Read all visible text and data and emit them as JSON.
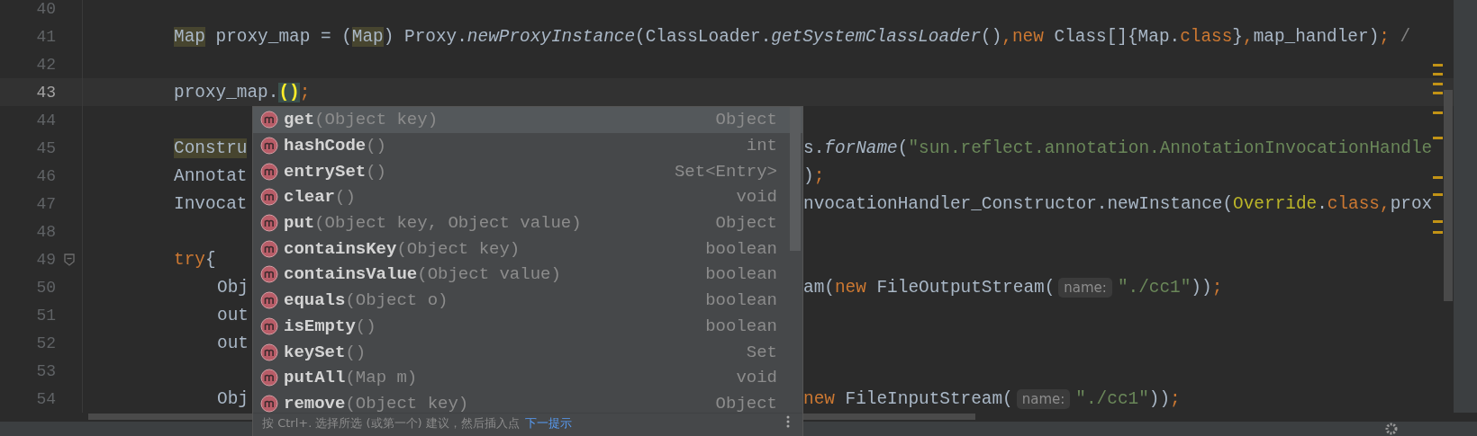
{
  "editor": {
    "lines": [
      {
        "number": "40",
        "current": false
      },
      {
        "number": "41",
        "current": false,
        "text": [
          {
            "kind": "code",
            "tokens": [
              {
                "t": "Map",
                "kind": "usage"
              },
              {
                "t": " proxy_map = (",
                "kind": "plain"
              },
              {
                "t": "Map",
                "kind": "usage"
              },
              {
                "t": ") Proxy.",
                "kind": "plain"
              },
              {
                "t": "newProxyInstance",
                "kind": "method"
              },
              {
                "t": "(ClassLoader.",
                "kind": "plain"
              },
              {
                "t": "getSystemClassLoader",
                "kind": "method"
              },
              {
                "t": "()",
                "kind": "plain"
              },
              {
                "t": ",new",
                "kind": "keyword"
              },
              {
                "t": " Class[]{Map.",
                "kind": "plain"
              },
              {
                "t": "class",
                "kind": "keyword"
              },
              {
                "t": "}",
                "kind": "plain"
              },
              {
                "t": ",",
                "kind": "keyword"
              },
              {
                "t": "map_handler)",
                "kind": "plain"
              },
              {
                "t": ";",
                "kind": "keyword"
              },
              {
                "t": " /",
                "kind": "comment"
              }
            ]
          }
        ]
      },
      {
        "number": "42",
        "current": false
      },
      {
        "number": "43",
        "current": true,
        "text": [
          {
            "kind": "code",
            "tokens": [
              {
                "t": "proxy_map.",
                "kind": "plain"
              },
              {
                "t": "()",
                "kind": "brace-match"
              },
              {
                "t": ";",
                "kind": "keyword"
              }
            ]
          }
        ]
      },
      {
        "number": "44",
        "current": false
      },
      {
        "number": "45",
        "current": false,
        "text": [
          {
            "kind": "code",
            "tokens": [
              {
                "t": "Constru",
                "kind": "usage"
              }
            ]
          }
        ],
        "beyond_popup": [
          {
            "kind": "code",
            "tokens": [
              {
                "t": "s.",
                "kind": "plain"
              },
              {
                "t": "forName",
                "kind": "method"
              },
              {
                "t": "(",
                "kind": "plain"
              },
              {
                "t": "\"sun.reflect.annotation.AnnotationInvocationHandle",
                "kind": "string"
              }
            ]
          }
        ]
      },
      {
        "number": "46",
        "current": false,
        "text": [
          {
            "kind": "code",
            "tokens": [
              {
                "t": "Annotat",
                "kind": "plain"
              }
            ]
          }
        ],
        "beyond_popup": [
          {
            "kind": "code",
            "tokens": [
              {
                "t": ")",
                "kind": "plain"
              },
              {
                "t": ";",
                "kind": "keyword"
              }
            ]
          }
        ]
      },
      {
        "number": "47",
        "current": false,
        "text": [
          {
            "kind": "code",
            "tokens": [
              {
                "t": "Invocat",
                "kind": "plain"
              }
            ]
          }
        ],
        "beyond_popup": [
          {
            "kind": "code",
            "tokens": [
              {
                "t": "nvocationHandler_Constructor.newInstance(",
                "kind": "plain"
              },
              {
                "t": "Override",
                "kind": "annotation"
              },
              {
                "t": ".",
                "kind": "plain"
              },
              {
                "t": "class",
                "kind": "keyword"
              },
              {
                "t": ",",
                "kind": "keyword"
              },
              {
                "t": "prox",
                "kind": "plain"
              }
            ]
          }
        ]
      },
      {
        "number": "48",
        "current": false
      },
      {
        "number": "49",
        "current": false,
        "fold": true,
        "text": [
          {
            "kind": "code",
            "tokens": [
              {
                "t": "try",
                "kind": "keyword"
              },
              {
                "t": "{",
                "kind": "plain"
              }
            ]
          }
        ],
        "children": [
          {
            "number": "50",
            "current": false,
            "text": [
              {
                "kind": "code",
                "tokens": [
                  {
                    "t": "Obj",
                    "kind": "plain"
                  }
                ]
              }
            ],
            "beyond_popup": [
              {
                "kind": "code",
                "tokens": [
                  {
                    "t": "am(",
                    "kind": "plain"
                  },
                  {
                    "t": "new",
                    "kind": "keyword"
                  },
                  {
                    "t": " FileOutputStream(",
                    "kind": "plain"
                  }
                ]
              },
              {
                "kind": "hint",
                "text": "name:"
              },
              {
                "kind": "code",
                "tokens": [
                  {
                    "t": "\"./cc1\"",
                    "kind": "string"
                  },
                  {
                    "t": "))",
                    "kind": "plain"
                  },
                  {
                    "t": ";",
                    "kind": "keyword"
                  }
                ]
              }
            ]
          },
          {
            "number": "51",
            "current": false,
            "text": [
              {
                "kind": "code",
                "tokens": [
                  {
                    "t": "out",
                    "kind": "plain"
                  }
                ]
              }
            ]
          },
          {
            "number": "52",
            "current": false,
            "text": [
              {
                "kind": "code",
                "tokens": [
                  {
                    "t": "out",
                    "kind": "plain"
                  }
                ]
              }
            ]
          },
          {
            "number": "53",
            "current": false
          },
          {
            "number": "54",
            "current": false,
            "text": [
              {
                "kind": "code",
                "tokens": [
                  {
                    "t": "Obj",
                    "kind": "plain"
                  }
                ]
              }
            ],
            "beyond_popup": [
              {
                "kind": "code",
                "tokens": [
                  {
                    "t": "new",
                    "kind": "keyword"
                  },
                  {
                    "t": " FileInputStream(",
                    "kind": "plain"
                  }
                ]
              },
              {
                "kind": "hint",
                "text": "name:"
              },
              {
                "kind": "code",
                "tokens": [
                  {
                    "t": "\"./cc1\"",
                    "kind": "string"
                  },
                  {
                    "t": "))",
                    "kind": "plain"
                  },
                  {
                    "t": ";",
                    "kind": "keyword"
                  }
                ]
              }
            ]
          }
        ]
      }
    ]
  },
  "completion_popup": {
    "items": [
      {
        "name": "get",
        "params": "(Object key)",
        "type": "Object",
        "selected": true
      },
      {
        "name": "hashCode",
        "params": "()",
        "type": "int",
        "selected": false
      },
      {
        "name": "entrySet",
        "params": "()",
        "type": "Set<Entry>",
        "selected": false
      },
      {
        "name": "clear",
        "params": "()",
        "type": "void",
        "selected": false
      },
      {
        "name": "put",
        "params": "(Object key, Object value)",
        "type": "Object",
        "selected": false
      },
      {
        "name": "containsKey",
        "params": "(Object key)",
        "type": "boolean",
        "selected": false
      },
      {
        "name": "containsValue",
        "params": "(Object value)",
        "type": "boolean",
        "selected": false
      },
      {
        "name": "equals",
        "params": "(Object o)",
        "type": "boolean",
        "selected": false
      },
      {
        "name": "isEmpty",
        "params": "()",
        "type": "boolean",
        "selected": false
      },
      {
        "name": "keySet",
        "params": "()",
        "type": "Set",
        "selected": false
      },
      {
        "name": "putAll",
        "params": "(Map m)",
        "type": "void",
        "selected": false
      },
      {
        "name": "remove",
        "params": "(Object key)",
        "type": "Object",
        "selected": false
      }
    ],
    "footer": {
      "text": "按 Ctrl+. 选择所选 (或第一个) 建议，然后插入点",
      "link": "下一提示"
    }
  }
}
